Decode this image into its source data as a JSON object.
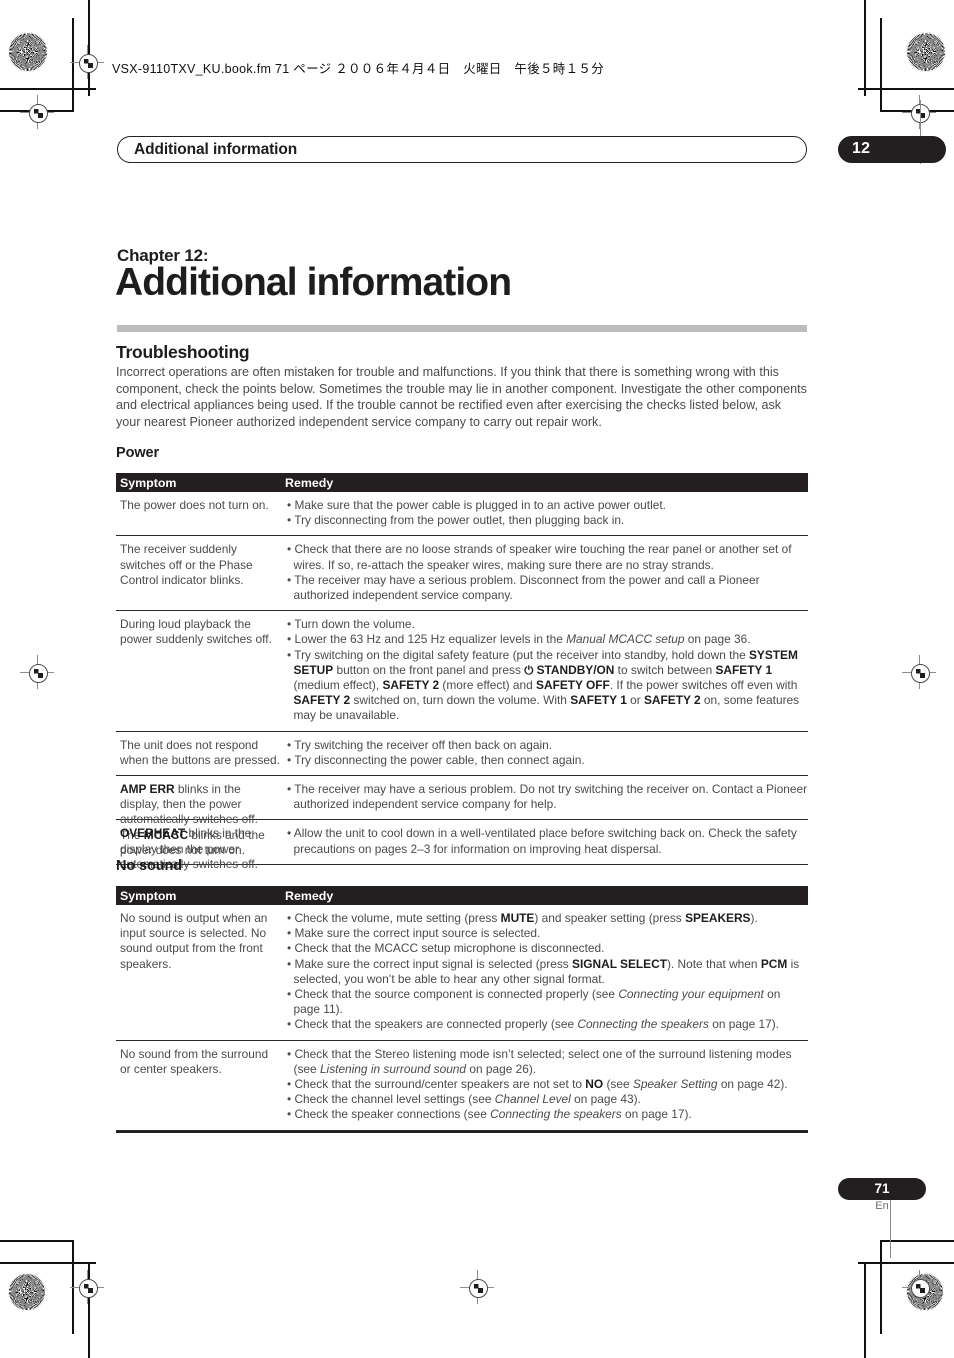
{
  "print_marks": {
    "filename_line": "VSX-9110TXV_KU.book.fm 71 ページ ２００６年４月４日　火曜日　午後５時１５分"
  },
  "running_header": {
    "title": "Additional information",
    "chapter_badge": "12"
  },
  "chapter": {
    "label": "Chapter 12:",
    "title": "Additional information"
  },
  "troubleshooting": {
    "heading": "Troubleshooting",
    "intro": "Incorrect operations are often mistaken for trouble and malfunctions. If you think that there is something wrong with this component, check the points below. Sometimes the trouble may lie in another component. Investigate the other components and electrical appliances being used. If the trouble cannot be rectified even after exercising the checks listed below, ask your nearest Pioneer authorized independent service company to carry out repair work."
  },
  "power_section": {
    "heading": "Power",
    "columns": {
      "symptom": "Symptom",
      "remedy": "Remedy"
    },
    "rows": [
      {
        "symptom": "The power does not turn on.",
        "remedy_html": "<p class=\"bul\">• Make sure that the power cable is plugged in to an active power outlet.</p><p class=\"bul\">• Try disconnecting from the power outlet, then plugging back in.</p>"
      },
      {
        "symptom": "The receiver suddenly switches off or the Phase Control indicator blinks.",
        "remedy_html": "<p class=\"bul\">• Check that there are no loose strands of speaker wire touching the rear panel or another set of wires. If so, re-attach the speaker wires, making sure there are no stray strands.</p><p class=\"bul\">• The receiver may have a serious problem. Disconnect from the power and call a Pioneer authorized independent service company.</p>"
      },
      {
        "symptom": "During loud playback the power suddenly switches off.",
        "remedy_html": "<p class=\"bul\">• Turn down the volume.</p><p class=\"bul\">• Lower the 63 Hz and 125 Hz equalizer levels in the <i>Manual MCACC setup</i> on page 36.</p><p class=\"bul\">• Try switching on the digital safety feature (put the receiver into standby, hold down the <b>SYSTEM SETUP</b> button on the front panel and press <span class=\"pwr\">⏻</span> <b>STANDBY/ON</b> to switch between <b>SAFETY 1</b> (medium effect), <b>SAFETY 2</b> (more effect) and <b>SAFETY OFF</b>. If the power switches off even with <b>SAFETY 2</b> switched on, turn down the volume. With <b>SAFETY 1</b> or <b>SAFETY 2</b> on, some features may be unavailable.</p>"
      },
      {
        "symptom": "The unit does not respond when the buttons are pressed.",
        "remedy_html": "<p class=\"bul\">• Try switching the receiver off then back on again.</p><p class=\"bul\">• Try disconnecting the power cable, then connect again.</p>"
      },
      {
        "symptom_html": "<b>AMP ERR</b> blinks in the display, then the power automatically switches off. The <b>MCACC</b> blinks and the power does not turn on.",
        "remedy_html": "<p class=\"bul\">• The receiver may have a serious problem. Do not try switching the receiver on. Contact a Pioneer authorized independent service company for help.</p>"
      },
      {
        "symptom_html": "<b>OVERHEAT</b> blinks in the display then the power automatically switches off.",
        "remedy_html": "<p class=\"bul\">• Allow the unit to cool down in a well-ventilated place before switching back on. Check the safety precautions on pages 2–3 for information on improving heat dispersal.</p>"
      }
    ]
  },
  "no_sound_section": {
    "heading": "No sound",
    "columns": {
      "symptom": "Symptom",
      "remedy": "Remedy"
    },
    "rows": [
      {
        "symptom": "No sound is output when an input source is selected. No sound output from the front speakers.",
        "remedy_html": "<p class=\"bul\">• Check the volume, mute setting (press <b>MUTE</b>) and speaker setting (press <b>SPEAKERS</b>).</p><p class=\"bul\">• Make sure the correct input source is selected.</p><p class=\"bul\">• Check that the MCACC setup microphone is disconnected.</p><p class=\"bul\">• Make sure the correct input signal is selected (press <b>SIGNAL SELECT</b>). Note that when <b>PCM</b> is selected, you won’t be able to hear any other signal format.</p><p class=\"bul\">• Check that the source component is connected properly (see <i>Connecting your equipment</i> on page 11).</p><p class=\"bul\">• Check that the speakers are connected properly (see <i>Connecting the speakers</i> on page 17).</p>"
      },
      {
        "symptom": "No sound from the surround or center speakers.",
        "remedy_html": "<p class=\"bul\">• Check that the Stereo listening mode isn’t selected; select one of the surround listening modes (see <i>Listening in surround sound</i> on page 26).</p><p class=\"bul\">• Check that the surround/center speakers are not set to <b>NO</b> (see <i>Speaker Setting</i> on page 42).</p><p class=\"bul\">• Check the channel level settings (see <i>Channel Level</i> on page 43).</p><p class=\"bul\">• Check the speaker connections (see <i>Connecting the speakers</i> on page 17).</p>"
      }
    ]
  },
  "footer": {
    "page_number": "71",
    "language": "En"
  },
  "colors": {
    "ink_black": "#231f20",
    "body_gray": "#4b4b4b",
    "rule_gray": "#bcbcbc"
  }
}
